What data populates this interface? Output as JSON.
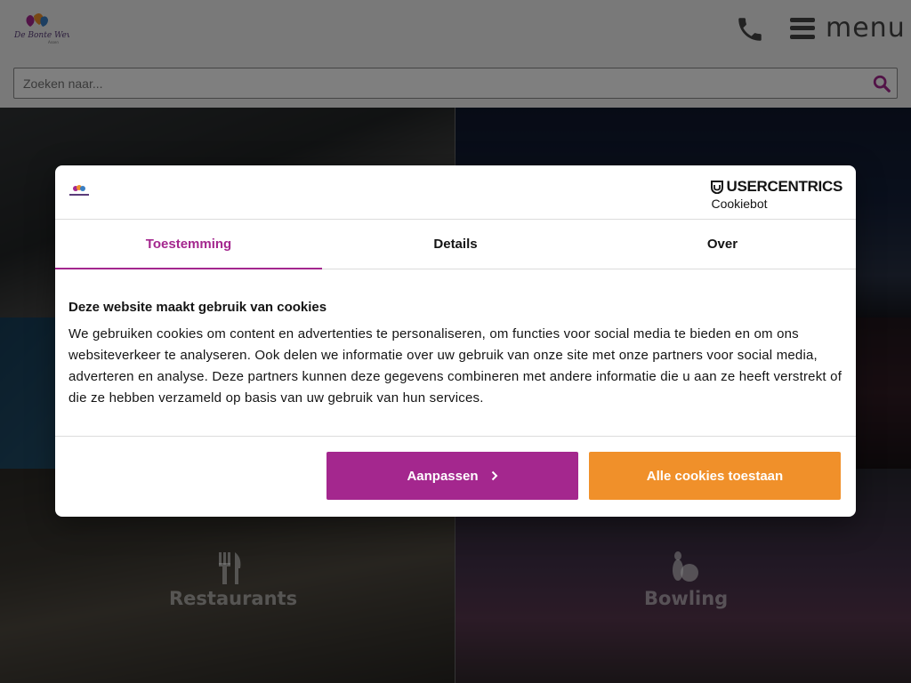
{
  "header": {
    "logo_icon": "de-bonte-wever-logo",
    "phone_icon": "phone-icon",
    "menu_label": "menu"
  },
  "search": {
    "placeholder": "Zoeken naar...",
    "icon": "search-icon"
  },
  "tiles": [
    {
      "label": "Restaurants",
      "icon": "cutlery-icon"
    },
    {
      "label": "Bowling",
      "icon": "bowling-icon"
    }
  ],
  "cookie_dialog": {
    "provider_brand": "USERCENTRICS",
    "provider_product": "Cookiebot",
    "tabs": [
      {
        "label": "Toestemming",
        "active": true
      },
      {
        "label": "Details",
        "active": false
      },
      {
        "label": "Over",
        "active": false
      }
    ],
    "heading": "Deze website maakt gebruik van cookies",
    "text": "We gebruiken cookies om content en advertenties te personaliseren, om functies voor social media te bieden en om ons websiteverkeer te analyseren. Ook delen we informatie over uw gebruik van onze site met onze partners voor social media, adverteren en analyse. Deze partners kunnen deze gegevens combineren met andere informatie die u aan ze heeft verstrekt of die ze hebben verzameld op basis van uw gebruik van hun services.",
    "customize_label": "Aanpassen",
    "allow_all_label": "Alle cookies toestaan"
  },
  "colors": {
    "accent_purple": "#a4278e",
    "accent_orange": "#f0902a"
  }
}
